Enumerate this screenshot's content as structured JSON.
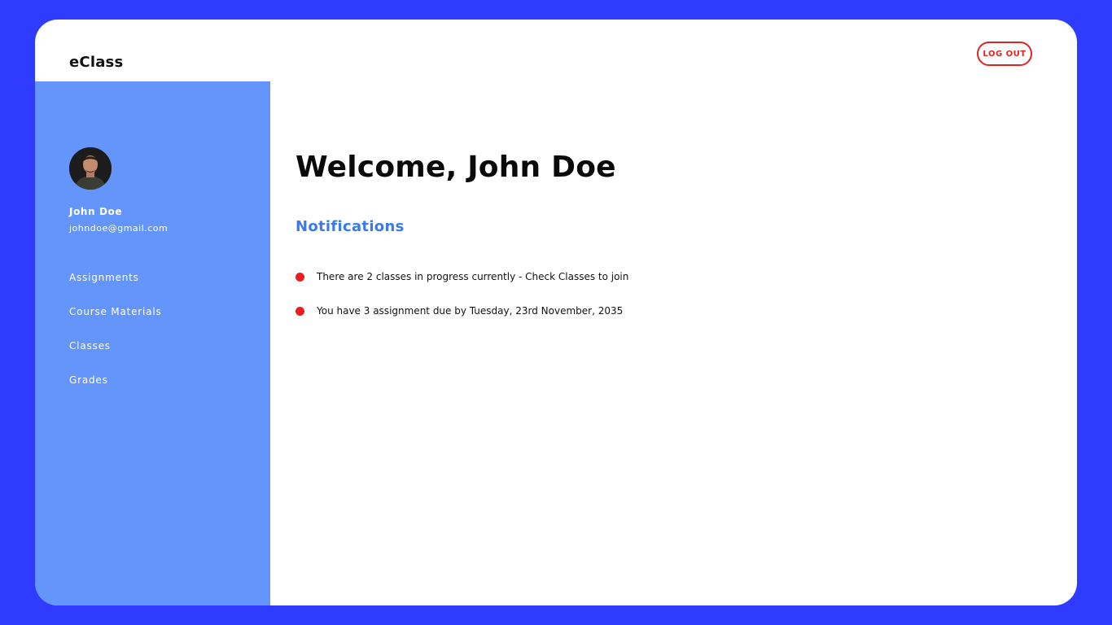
{
  "app": {
    "brand": "eClass",
    "logout_label": "LOG OUT"
  },
  "user": {
    "name": "John Doe",
    "email": "johndoe@gmail.com"
  },
  "sidebar": {
    "items": [
      {
        "label": "Assignments"
      },
      {
        "label": "Course Materials"
      },
      {
        "label": "Classes"
      },
      {
        "label": "Grades"
      }
    ]
  },
  "main": {
    "welcome": "Welcome, John Doe",
    "notifications_heading": "Notifications",
    "notifications": [
      {
        "text": "There are 2 classes in progress currently - Check Classes to join"
      },
      {
        "text": "You have 3 assignment due by Tuesday, 23rd November, 2035"
      }
    ]
  },
  "colors": {
    "background": "#2f3cff",
    "sidebar": "#6495fb",
    "accent": "#3b7be8",
    "alert": "#ee1c1c"
  }
}
